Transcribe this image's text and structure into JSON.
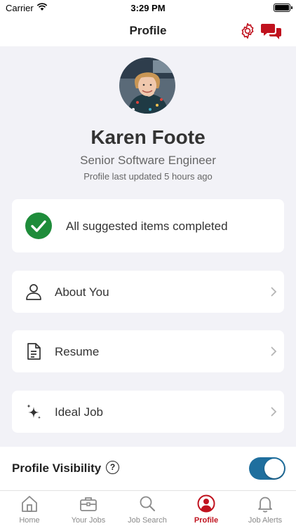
{
  "status_bar": {
    "carrier": "Carrier",
    "time": "3:29 PM"
  },
  "nav": {
    "title": "Profile",
    "settings_icon": "gear-icon",
    "messages_icon": "chat-bubbles-icon"
  },
  "profile": {
    "name": "Karen Foote",
    "job_title": "Senior Software Engineer",
    "last_updated": "Profile last updated 5 hours ago"
  },
  "suggestions": {
    "label": "All suggested items completed",
    "icon": "check-circle-icon"
  },
  "sections": [
    {
      "label": "About You",
      "icon": "person-icon"
    },
    {
      "label": "Resume",
      "icon": "document-icon"
    },
    {
      "label": "Ideal Job",
      "icon": "sparkles-icon"
    }
  ],
  "visibility": {
    "label": "Profile Visibility",
    "help": "?",
    "enabled": true
  },
  "tabs": [
    {
      "label": "Home",
      "icon": "home-icon",
      "active": false
    },
    {
      "label": "Your Jobs",
      "icon": "briefcase-icon",
      "active": false
    },
    {
      "label": "Job Search",
      "icon": "search-icon",
      "active": false
    },
    {
      "label": "Profile",
      "icon": "profile-icon",
      "active": true
    },
    {
      "label": "Job Alerts",
      "icon": "bell-icon",
      "active": false
    }
  ],
  "colors": {
    "accent": "#c0121e",
    "success": "#1e8c3a",
    "toggle": "#1f6f9e",
    "background": "#f2f2f7"
  }
}
